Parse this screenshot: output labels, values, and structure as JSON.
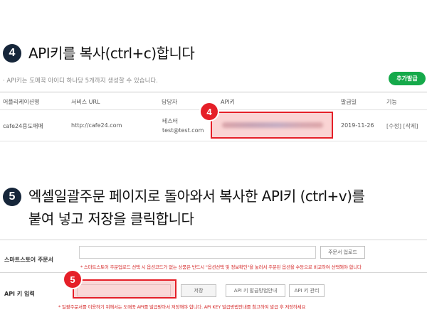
{
  "step4": {
    "number": "4",
    "title": "API키를 복사(ctrl+c)합니다",
    "note": "· API키는 도메꾹 아이디 하나당 5개까지 생성할 수 있습니다.",
    "add_key_button": "추가발급",
    "table": {
      "headers": [
        "어플리케이션명",
        "서비스 URL",
        "담당자",
        "API키",
        "발급일",
        "기능"
      ],
      "row": {
        "app_name": "cafe24용도매매",
        "service_url": "http://cafe24.com",
        "manager_name": "테스터",
        "manager_email": "test@test.com",
        "api_key": "",
        "issued_date": "2019-11-26",
        "actions": "[수정] [삭제]"
      }
    },
    "marker": "4"
  },
  "step5": {
    "number": "5",
    "title_line1": "엑셀일괄주문 페이지로 돌아와서 복사한 API키 (ctrl+v)를",
    "title_line2": "붙여 넣고 저장을 클릭합니다",
    "smartstore_label": "스마트스토어 주문서",
    "upload_button": "주문서 업로드",
    "smartstore_note": "* 스마트스토어 주문업로드 선택 시 옵션코드가 없는 상품은 반드시 \"옵션선택 및 정보확인\"을 눌러서 주문된 옵션을 수동으로 비교하여 선택해야 합니다",
    "api_label": "API 키 입력",
    "save_button": "저장",
    "guide_button": "API 키 발급방법안내",
    "manage_button": "API 키 관리",
    "api_note": "* 일괄주문서를 이용하기 위해서는 도매꾹 API를 발급받아서 저장해야 합니다. API KEY 발급방법안내를 참고하여 발급 후 저장하세요",
    "marker": "5"
  },
  "colors": {
    "badge_dark": "#16263a",
    "marker_red": "#e51f28",
    "add_button_green": "#15a94a",
    "note_red": "#d52a2a"
  }
}
